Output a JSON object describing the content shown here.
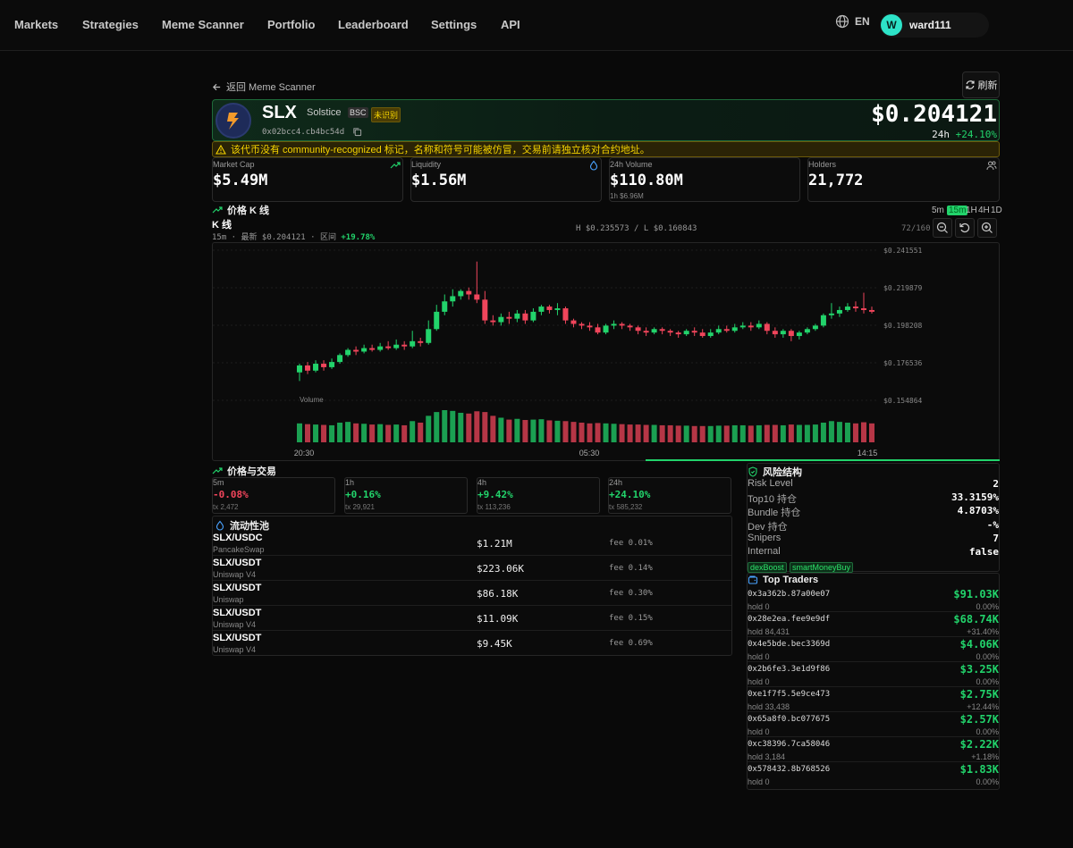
{
  "nav": {
    "items": [
      "Markets",
      "Strategies",
      "Meme Scanner",
      "Portfolio",
      "Leaderboard",
      "Settings",
      "API"
    ],
    "lang": "EN",
    "avatar_letter": "W",
    "username": "ward111"
  },
  "toolbar": {
    "back_label": "返回 Meme Scanner",
    "refresh_label": "刷新"
  },
  "token": {
    "symbol": "SLX",
    "name": "Solstice",
    "chain": "BSC",
    "unverified_badge": "未识别",
    "address": "0x02bcc4.cb4bc54d",
    "price": "$0.204121",
    "change_label": "24h",
    "change_value": "+24.10%"
  },
  "warning": "该代币没有 community-recognized 标记，名称和符号可能被仿冒，交易前请独立核对合约地址。",
  "stats": [
    {
      "label": "Market Cap",
      "value": "$5.49M",
      "sub": "",
      "icon": "trend-up-icon"
    },
    {
      "label": "Liquidity",
      "value": "$1.56M",
      "sub": "",
      "icon": "droplet-icon"
    },
    {
      "label": "24h Volume",
      "value": "$110.80M",
      "sub": "1h $6.96M",
      "icon": ""
    },
    {
      "label": "Holders",
      "value": "21,772",
      "sub": "",
      "icon": "users-icon"
    }
  ],
  "chart_section": {
    "title": "价格 K 线",
    "kline_title": "K 线",
    "timeframes": [
      "5m",
      "15m",
      "1H",
      "4H",
      "1D"
    ],
    "active_timeframe": "15m",
    "sub_prefix": "15m · 最新 $0.204121 · 区间",
    "sub_change": "+19.78%",
    "hl_label": "H $0.235573 / L $0.160843",
    "count_label": "72/160"
  },
  "chart_data": {
    "type": "candlestick",
    "y_ticks": [
      "$0.241551",
      "$0.219879",
      "$0.198208",
      "$0.176536",
      "$0.154864"
    ],
    "ylim": [
      0.154864,
      0.241551
    ],
    "x_ticks": [
      "20:30",
      "05:30",
      "14:15"
    ],
    "volume_label": "Volume",
    "candles": [
      [
        0.171,
        0.175,
        0.166,
        0.176,
        500
      ],
      [
        0.175,
        0.172,
        0.17,
        0.177,
        480
      ],
      [
        0.172,
        0.176,
        0.171,
        0.178,
        470
      ],
      [
        0.176,
        0.174,
        0.172,
        0.178,
        460
      ],
      [
        0.174,
        0.177,
        0.173,
        0.179,
        450
      ],
      [
        0.177,
        0.181,
        0.176,
        0.182,
        520
      ],
      [
        0.181,
        0.184,
        0.18,
        0.185,
        540
      ],
      [
        0.184,
        0.183,
        0.181,
        0.186,
        500
      ],
      [
        0.183,
        0.185,
        0.182,
        0.187,
        490
      ],
      [
        0.185,
        0.184,
        0.183,
        0.187,
        470
      ],
      [
        0.184,
        0.186,
        0.183,
        0.188,
        480
      ],
      [
        0.186,
        0.185,
        0.184,
        0.189,
        460
      ],
      [
        0.185,
        0.187,
        0.184,
        0.19,
        470
      ],
      [
        0.187,
        0.186,
        0.184,
        0.189,
        450
      ],
      [
        0.186,
        0.189,
        0.185,
        0.195,
        560
      ],
      [
        0.189,
        0.188,
        0.186,
        0.191,
        520
      ],
      [
        0.188,
        0.196,
        0.187,
        0.201,
        700
      ],
      [
        0.196,
        0.206,
        0.195,
        0.21,
        800
      ],
      [
        0.206,
        0.212,
        0.204,
        0.216,
        850
      ],
      [
        0.212,
        0.215,
        0.209,
        0.219,
        830
      ],
      [
        0.215,
        0.218,
        0.213,
        0.219,
        780
      ],
      [
        0.218,
        0.216,
        0.213,
        0.22,
        760
      ],
      [
        0.216,
        0.213,
        0.211,
        0.235,
        820
      ],
      [
        0.213,
        0.201,
        0.199,
        0.218,
        800
      ],
      [
        0.201,
        0.2,
        0.198,
        0.204,
        700
      ],
      [
        0.2,
        0.203,
        0.198,
        0.205,
        650
      ],
      [
        0.203,
        0.202,
        0.199,
        0.206,
        600
      ],
      [
        0.202,
        0.205,
        0.2,
        0.207,
        620
      ],
      [
        0.205,
        0.201,
        0.199,
        0.207,
        590
      ],
      [
        0.201,
        0.206,
        0.2,
        0.208,
        600
      ],
      [
        0.206,
        0.209,
        0.204,
        0.21,
        610
      ],
      [
        0.209,
        0.207,
        0.205,
        0.21,
        580
      ],
      [
        0.207,
        0.208,
        0.204,
        0.211,
        570
      ],
      [
        0.208,
        0.201,
        0.199,
        0.209,
        560
      ],
      [
        0.201,
        0.199,
        0.197,
        0.202,
        540
      ],
      [
        0.199,
        0.198,
        0.196,
        0.2,
        520
      ],
      [
        0.198,
        0.197,
        0.195,
        0.2,
        500
      ],
      [
        0.197,
        0.194,
        0.193,
        0.199,
        510
      ],
      [
        0.194,
        0.198,
        0.193,
        0.199,
        500
      ],
      [
        0.198,
        0.199,
        0.196,
        0.201,
        490
      ],
      [
        0.199,
        0.198,
        0.196,
        0.2,
        480
      ],
      [
        0.198,
        0.197,
        0.195,
        0.199,
        470
      ],
      [
        0.197,
        0.195,
        0.193,
        0.198,
        470
      ],
      [
        0.195,
        0.194,
        0.192,
        0.197,
        460
      ],
      [
        0.194,
        0.196,
        0.193,
        0.197,
        460
      ],
      [
        0.196,
        0.195,
        0.193,
        0.197,
        450
      ],
      [
        0.195,
        0.194,
        0.192,
        0.196,
        450
      ],
      [
        0.194,
        0.193,
        0.191,
        0.195,
        440
      ],
      [
        0.193,
        0.195,
        0.192,
        0.196,
        440
      ],
      [
        0.195,
        0.194,
        0.192,
        0.197,
        430
      ],
      [
        0.194,
        0.192,
        0.191,
        0.196,
        430
      ],
      [
        0.192,
        0.194,
        0.191,
        0.196,
        430
      ],
      [
        0.194,
        0.196,
        0.193,
        0.198,
        440
      ],
      [
        0.196,
        0.195,
        0.194,
        0.198,
        440
      ],
      [
        0.195,
        0.197,
        0.194,
        0.199,
        450
      ],
      [
        0.197,
        0.198,
        0.196,
        0.2,
        450
      ],
      [
        0.198,
        0.197,
        0.195,
        0.2,
        440
      ],
      [
        0.197,
        0.199,
        0.196,
        0.201,
        450
      ],
      [
        0.199,
        0.195,
        0.193,
        0.2,
        460
      ],
      [
        0.195,
        0.193,
        0.191,
        0.197,
        460
      ],
      [
        0.193,
        0.195,
        0.191,
        0.196,
        450
      ],
      [
        0.195,
        0.192,
        0.189,
        0.196,
        470
      ],
      [
        0.192,
        0.194,
        0.19,
        0.195,
        460
      ],
      [
        0.194,
        0.196,
        0.193,
        0.197,
        460
      ],
      [
        0.196,
        0.198,
        0.195,
        0.199,
        470
      ],
      [
        0.198,
        0.204,
        0.197,
        0.205,
        520
      ],
      [
        0.204,
        0.205,
        0.202,
        0.211,
        560
      ],
      [
        0.205,
        0.207,
        0.203,
        0.209,
        540
      ],
      [
        0.207,
        0.209,
        0.206,
        0.211,
        520
      ],
      [
        0.209,
        0.208,
        0.206,
        0.212,
        500
      ],
      [
        0.208,
        0.207,
        0.205,
        0.217,
        530
      ],
      [
        0.207,
        0.206,
        0.205,
        0.209,
        500
      ]
    ]
  },
  "price_trade": {
    "title": "价格与交易",
    "cells": [
      {
        "period": "5m",
        "change": "-0.08%",
        "dir": "neg",
        "tx": "tx 2,472"
      },
      {
        "period": "1h",
        "change": "+0.16%",
        "dir": "pos",
        "tx": "tx 29,921"
      },
      {
        "period": "4h",
        "change": "+9.42%",
        "dir": "pos",
        "tx": "tx 113,236"
      },
      {
        "period": "24h",
        "change": "+24.10%",
        "dir": "pos",
        "tx": "tx 585,232"
      }
    ]
  },
  "liquidity": {
    "title": "流动性池",
    "rows": [
      {
        "pair": "SLX/USDC",
        "dex": "PancakeSwap",
        "liq": "$1.21M",
        "fee": "fee 0.01%"
      },
      {
        "pair": "SLX/USDT",
        "dex": "Uniswap V4",
        "liq": "$223.06K",
        "fee": "fee 0.14%"
      },
      {
        "pair": "SLX/USDT",
        "dex": "Uniswap",
        "liq": "$86.18K",
        "fee": "fee 0.30%"
      },
      {
        "pair": "SLX/USDT",
        "dex": "Uniswap V4",
        "liq": "$11.09K",
        "fee": "fee 0.15%"
      },
      {
        "pair": "SLX/USDT",
        "dex": "Uniswap V4",
        "liq": "$9.45K",
        "fee": "fee 0.69%"
      }
    ]
  },
  "risk": {
    "title": "风险结构",
    "rows": [
      {
        "k": "Risk Level",
        "v": "2"
      },
      {
        "k": "Top10 持仓",
        "v": "33.3159%"
      },
      {
        "k": "Bundle 持仓",
        "v": "4.8703%"
      },
      {
        "k": "Dev 持仓",
        "v": "-%"
      },
      {
        "k": "Snipers",
        "v": "7"
      },
      {
        "k": "Internal",
        "v": "false"
      }
    ],
    "tags": [
      "dexBoost",
      "smartMoneyBuy"
    ]
  },
  "traders": {
    "title": "Top Traders",
    "rows": [
      {
        "addr": "0x3a362b.87a00e07",
        "pnl": "$91.03K",
        "hold": "hold 0",
        "pct": "0.00%"
      },
      {
        "addr": "0x28e2ea.fee9e9df",
        "pnl": "$68.74K",
        "hold": "hold 84,431",
        "pct": "+31.40%"
      },
      {
        "addr": "0x4e5bde.bec3369d",
        "pnl": "$4.06K",
        "hold": "hold 0",
        "pct": "0.00%"
      },
      {
        "addr": "0x2b6fe3.3e1d9f86",
        "pnl": "$3.25K",
        "hold": "hold 0",
        "pct": "0.00%"
      },
      {
        "addr": "0xe1f7f5.5e9ce473",
        "pnl": "$2.75K",
        "hold": "hold 33,438",
        "pct": "+12.44%"
      },
      {
        "addr": "0x65a8f0.bc077675",
        "pnl": "$2.57K",
        "hold": "hold 0",
        "pct": "0.00%"
      },
      {
        "addr": "0xc38396.7ca58046",
        "pnl": "$2.22K",
        "hold": "hold 3,184",
        "pct": "+1.18%"
      },
      {
        "addr": "0x578432.8b768526",
        "pnl": "$1.83K",
        "hold": "hold 0",
        "pct": "0.00%"
      }
    ]
  },
  "colors": {
    "up": "#22d36b",
    "down": "#f0455b",
    "accent": "#2de3c8"
  }
}
